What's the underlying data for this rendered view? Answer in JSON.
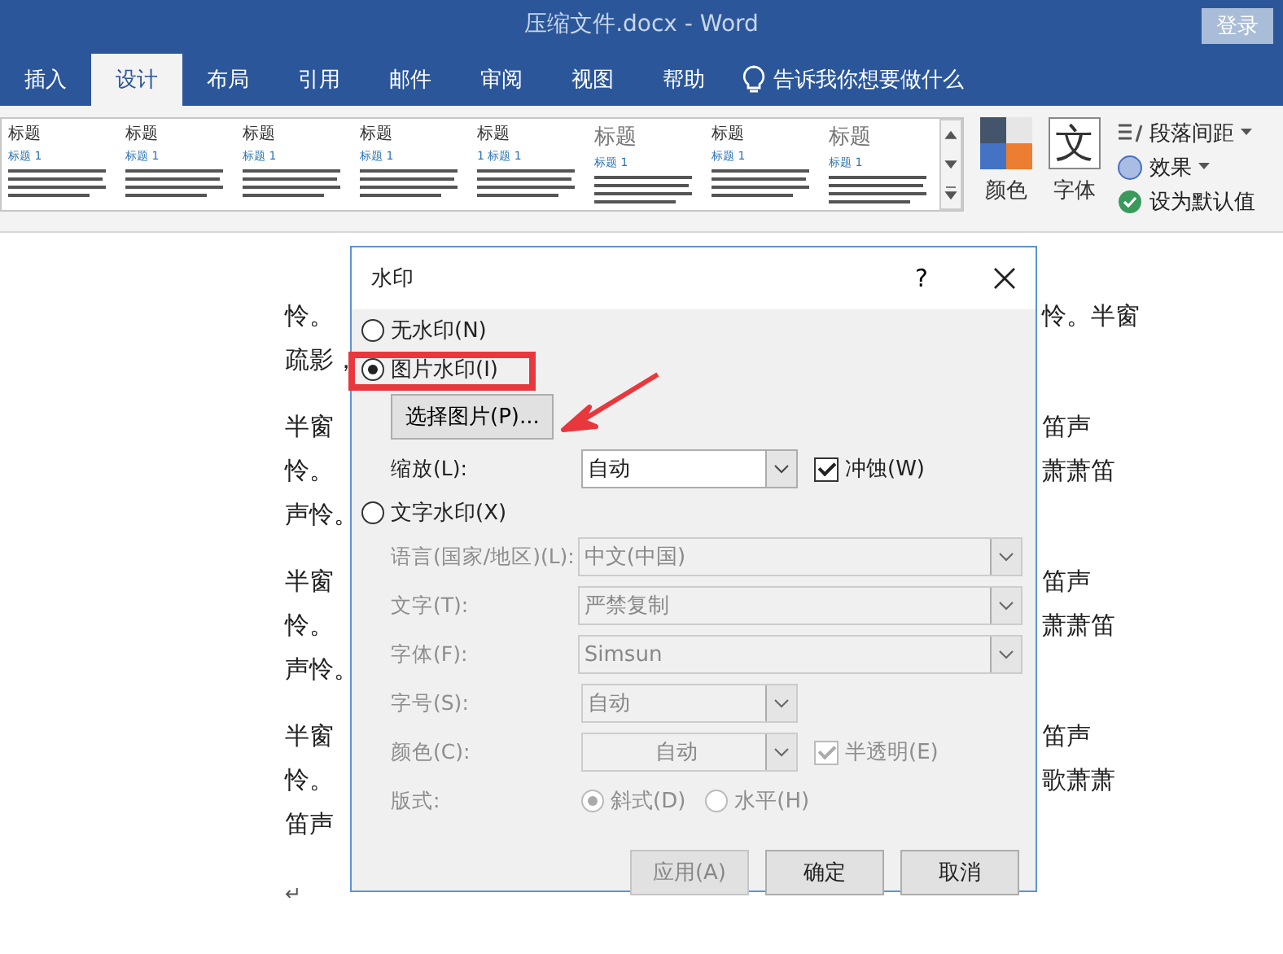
{
  "window": {
    "title": "压缩文件.docx  -  Word",
    "sign_in": "登录"
  },
  "tabs": [
    {
      "label": "插入",
      "selected": false
    },
    {
      "label": "设计",
      "selected": true
    },
    {
      "label": "布局",
      "selected": false
    },
    {
      "label": "引用",
      "selected": false
    },
    {
      "label": "邮件",
      "selected": false
    },
    {
      "label": "审阅",
      "selected": false
    },
    {
      "label": "视图",
      "selected": false
    },
    {
      "label": "帮助",
      "selected": false
    }
  ],
  "tell_me": "告诉我你想要做什么",
  "ribbon": {
    "style_gallery": [
      {
        "title": "标题",
        "heading": "标题 1"
      },
      {
        "title": "标题",
        "heading": "标题 1"
      },
      {
        "title": "标题",
        "heading": "标题 1"
      },
      {
        "title": "标题",
        "heading": "标题 1"
      },
      {
        "title": "标题",
        "heading": "1  标题 1"
      },
      {
        "title": "标题",
        "heading": "标题 1"
      },
      {
        "title": "标题",
        "heading": "标题 1"
      },
      {
        "title": "标题",
        "heading": "标题 1"
      }
    ],
    "colors": "颜色",
    "fonts": "字体",
    "fonts_glyph": "文",
    "paragraph_spacing": "段落间距",
    "effects": "效果",
    "set_default": "设为默认值"
  },
  "document": {
    "paragraphs": [
      {
        "lines": [
          {
            "left": "怜。",
            "right": "怜。半窗"
          },
          {
            "left": "疏影，"
          }
        ]
      },
      {
        "lines": [
          {
            "left": "半窗",
            "right": "笛声"
          },
          {
            "left": "怜。",
            "right": "萧萧笛"
          },
          {
            "left": "声怜。"
          }
        ]
      },
      {
        "lines": [
          {
            "left": "半窗",
            "right": "笛声"
          },
          {
            "left": "怜。",
            "right": "萧萧笛"
          },
          {
            "left": "声怜。"
          }
        ]
      },
      {
        "lines": [
          {
            "left": "半窗",
            "right": "笛声"
          },
          {
            "left": "怜。",
            "right": "歌萧萧"
          },
          {
            "left": "笛声"
          }
        ]
      }
    ],
    "end_mark": "↵"
  },
  "dialog": {
    "title": "水印",
    "help": "?",
    "options": [
      {
        "label": "无水印(N)",
        "selected": false
      },
      {
        "label": "图片水印(I)",
        "selected": true
      },
      {
        "label": "文字水印(X)",
        "selected": false
      }
    ],
    "select_picture": "选择图片(P)...",
    "scale": {
      "label": "缩放(L):",
      "value": "自动"
    },
    "washout": {
      "label": "冲蚀(W)",
      "checked": true
    },
    "text_fields": [
      {
        "label": "语言(国家/地区)(L):",
        "value": "中文(中国)",
        "wide": true
      },
      {
        "label": "文字(T):",
        "value": "严禁复制",
        "wide": true
      },
      {
        "label": "字体(F):",
        "value": "Simsun",
        "wide": true
      },
      {
        "label": "字号(S):",
        "value": "自动",
        "wide": false
      },
      {
        "label": "颜色(C):",
        "value": "自动",
        "wide": false
      }
    ],
    "semitransparent": {
      "label": "半透明(E)",
      "checked": true
    },
    "layout": {
      "label": "版式:",
      "options": [
        {
          "label": "斜式(D)",
          "selected": true
        },
        {
          "label": "水平(H)",
          "selected": false
        }
      ]
    },
    "buttons": [
      {
        "label": "应用(A)",
        "disabled": true
      },
      {
        "label": "确定",
        "disabled": false
      },
      {
        "label": "取消",
        "disabled": false
      }
    ]
  }
}
